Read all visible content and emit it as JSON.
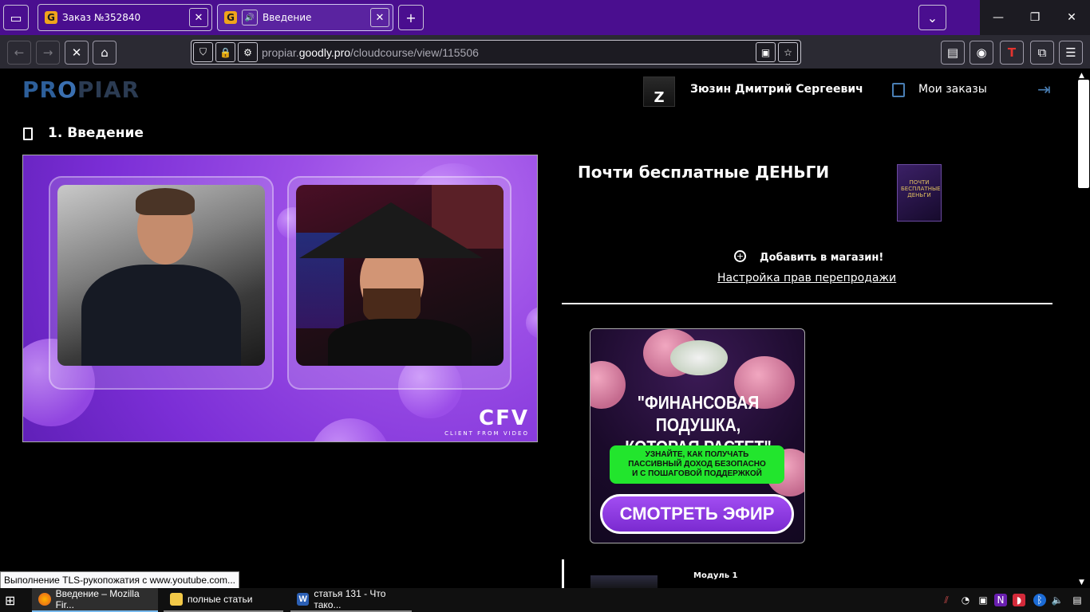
{
  "browser": {
    "tabs": [
      {
        "title": "Заказ №352840",
        "favicon": "goodly-icon",
        "active": false
      },
      {
        "title": "Введение",
        "favicon": "goodly-icon",
        "active": true,
        "audio": true
      }
    ],
    "new_tab_label": "+",
    "url_host_prefix": "propiar.",
    "url_host": "goodly.pro",
    "url_path": "/cloudcourse/view/115506",
    "accent_color": "#4a0e8f"
  },
  "site": {
    "logo": {
      "part1": "PR",
      "part2": "O",
      "part3": "PIAR"
    },
    "user_name": "Зюзин Дмитрий Сергеевич",
    "orders_label": "Мои заказы",
    "avatar_letter": "Z"
  },
  "lesson": {
    "title": "1. Введение",
    "video": {
      "brand": "CFV",
      "brand_sub": "CLIENT FROM VIDEO"
    }
  },
  "course": {
    "title": "Почти бесплатные ДЕНЬГИ",
    "box_text": "ПОЧТИ БЕСПЛАТНЫЕ ДЕНЬГИ",
    "add_to_shop": "Добавить в магазин!",
    "resale_link": "Настройка прав перепродажи"
  },
  "banner": {
    "headline_line1": "\"ФИНАНСОВАЯ ПОДУШКА,",
    "headline_line2": "КОТОРАЯ РАСТЕТ\"",
    "sub_line1": "УЗНАЙТЕ, КАК ПОЛУЧАТЬ",
    "sub_line2": "ПАССИВНЫЙ ДОХОД БЕЗОПАСНО",
    "sub_line3": "И С ПОШАГОВОЙ ПОДДЕРЖКОЙ",
    "button": "СМОТРЕТЬ ЭФИР"
  },
  "module": {
    "label": "Модуль 1"
  },
  "status_text": "Выполнение TLS-рукопожатия с www.youtube.com...",
  "taskbar": {
    "items": [
      {
        "label": "Введение – Mozilla Fir...",
        "icon": "firefox-icon",
        "active": true
      },
      {
        "label": "полные статьи",
        "icon": "folder-icon",
        "active": false
      },
      {
        "label": "статья 131 - Что тако...",
        "icon": "word-icon",
        "active": false
      }
    ]
  }
}
